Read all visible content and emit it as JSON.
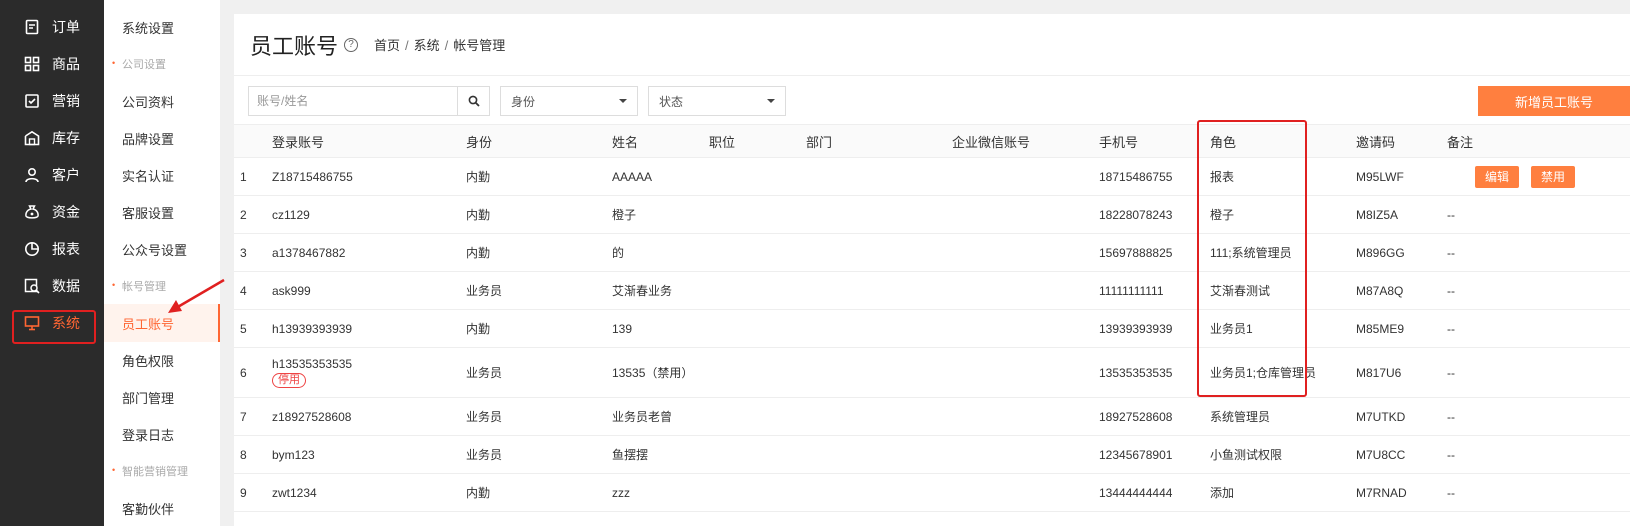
{
  "main_nav": [
    {
      "label": "订单",
      "icon": "order-icon"
    },
    {
      "label": "商品",
      "icon": "grid-icon"
    },
    {
      "label": "营销",
      "icon": "marketing-icon"
    },
    {
      "label": "库存",
      "icon": "warehouse-icon"
    },
    {
      "label": "客户",
      "icon": "user-icon"
    },
    {
      "label": "资金",
      "icon": "money-bag-icon"
    },
    {
      "label": "报表",
      "icon": "pie-chart-icon"
    },
    {
      "label": "数据",
      "icon": "data-search-icon"
    },
    {
      "label": "系统",
      "icon": "monitor-icon",
      "active": true
    }
  ],
  "sub_nav": {
    "system_settings": "系统设置",
    "group_company": "公司设置",
    "company_info": "公司资料",
    "brand_settings": "品牌设置",
    "real_name": "实名认证",
    "service_settings": "客服设置",
    "official_account": "公众号设置",
    "group_account": "帐号管理",
    "staff_account": "员工账号",
    "role_permission": "角色权限",
    "dept_manage": "部门管理",
    "login_log": "登录日志",
    "group_smart": "智能营销管理",
    "partial": "客勤伙伴"
  },
  "header": {
    "title": "员工账号",
    "help": "?",
    "breadcrumb": [
      "首页",
      "系统",
      "帐号管理"
    ]
  },
  "filters": {
    "search_placeholder": "账号/姓名",
    "identity_label": "身份",
    "status_label": "状态",
    "add_button": "新增员工账号"
  },
  "table": {
    "headers": {
      "account": "登录账号",
      "identity": "身份",
      "name": "姓名",
      "position": "职位",
      "dept": "部门",
      "wechat": "企业微信账号",
      "phone": "手机号",
      "role": "角色",
      "invite": "邀请码",
      "note": "备注"
    },
    "ops": {
      "edit": "编辑",
      "ban": "禁用"
    },
    "disabled_tag": "停用",
    "rows": [
      {
        "idx": "1",
        "account": "Z18715486755",
        "identity": "内勤",
        "name": "AAAAA",
        "phone": "18715486755",
        "role": "报表",
        "invite": "M95LWF",
        "note": ""
      },
      {
        "idx": "2",
        "account": "cz1129",
        "identity": "内勤",
        "name": "橙子",
        "phone": "18228078243",
        "role": "橙子",
        "invite": "M8IZ5A",
        "note": "--"
      },
      {
        "idx": "3",
        "account": "a1378467882",
        "identity": "内勤",
        "name": "的",
        "phone": "15697888825",
        "role": "111;系统管理员",
        "invite": "M896GG",
        "note": "--"
      },
      {
        "idx": "4",
        "account": "ask999",
        "identity": "业务员",
        "name": "艾渐春业务",
        "phone": "11111111111",
        "role": "艾渐春测试",
        "invite": "M87A8Q",
        "note": "--"
      },
      {
        "idx": "5",
        "account": "h13939393939",
        "identity": "内勤",
        "name": "139",
        "phone": "13939393939",
        "role": "业务员1",
        "invite": "M85ME9",
        "note": "--"
      },
      {
        "idx": "6",
        "account": "h13535353535",
        "identity": "业务员",
        "name": "13535（禁用）",
        "phone": "13535353535",
        "role": "业务员1;仓库管理员",
        "invite": "M817U6",
        "note": "--",
        "disabled": true
      },
      {
        "idx": "7",
        "account": "z18927528608",
        "identity": "业务员",
        "name": "业务员老曾",
        "phone": "18927528608",
        "role": "系统管理员",
        "invite": "M7UTKD",
        "note": "--"
      },
      {
        "idx": "8",
        "account": "bym123",
        "identity": "业务员",
        "name": "鱼摆摆",
        "phone": "12345678901",
        "role": "小鱼测试权限",
        "invite": "M7U8CC",
        "note": "--"
      },
      {
        "idx": "9",
        "account": "zwt1234",
        "identity": "内勤",
        "name": "zzz",
        "phone": "13444444444",
        "role": "添加",
        "invite": "M7RNAD",
        "note": "--"
      }
    ]
  },
  "colors": {
    "accent": "#ff6633",
    "button": "#ff7f3f",
    "annotation": "#e02020",
    "sidebar_bg": "#2b2b2b"
  }
}
